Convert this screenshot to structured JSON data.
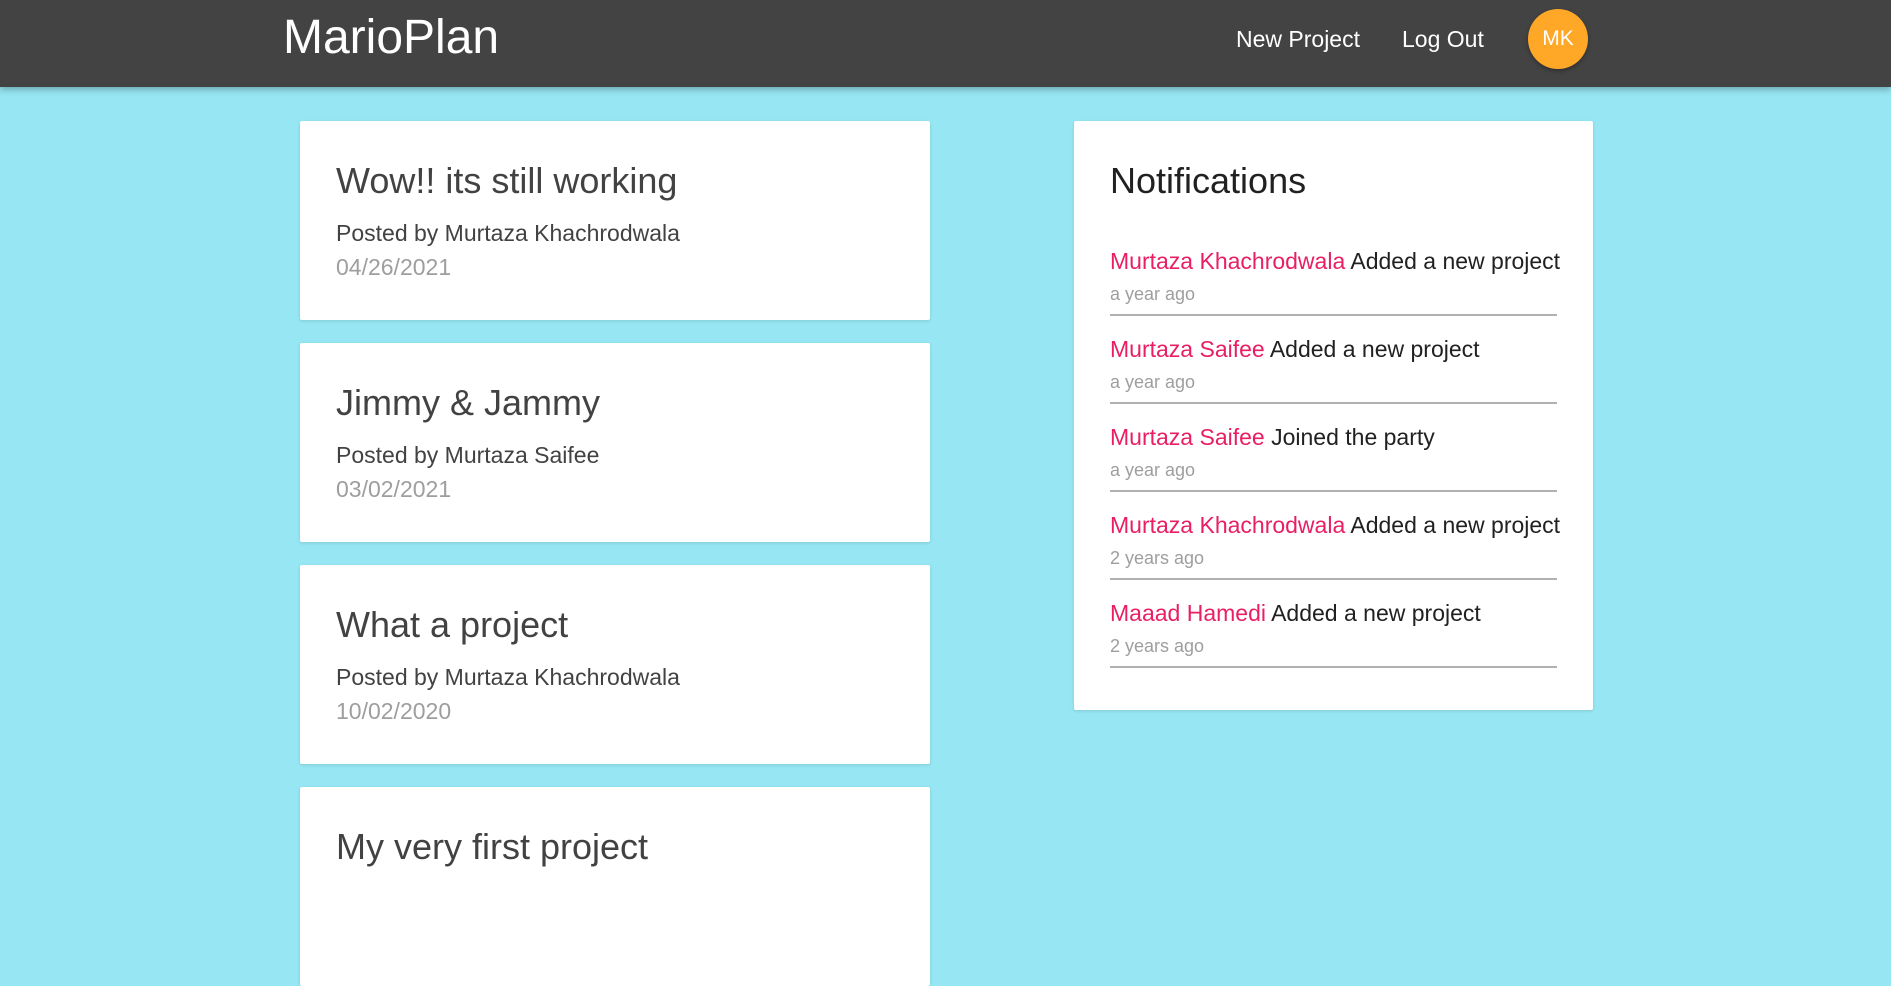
{
  "navbar": {
    "brand": "MarioPlan",
    "links": {
      "new_project": "New Project",
      "log_out": "Log Out"
    },
    "avatar_initials": "MK",
    "avatar_color": "#ffa726",
    "background_color": "#434343"
  },
  "page": {
    "background_color": "#96e6f3"
  },
  "projects": [
    {
      "title": "Wow!! its still working",
      "author": "Posted by Murtaza Khachrodwala",
      "date": "04/26/2021"
    },
    {
      "title": "Jimmy & Jammy",
      "author": "Posted by Murtaza Saifee",
      "date": "03/02/2021"
    },
    {
      "title": "What a project",
      "author": "Posted by Murtaza Khachrodwala",
      "date": "10/02/2020"
    },
    {
      "title": "My very first project",
      "author": "",
      "date": ""
    }
  ],
  "notifications": {
    "title": "Notifications",
    "accent_color": "#e91e63",
    "items": [
      {
        "user": "Murtaza Khachrodwala",
        "content": "Added a new project",
        "time": "a year ago"
      },
      {
        "user": "Murtaza Saifee",
        "content": "Added a new project",
        "time": "a year ago"
      },
      {
        "user": "Murtaza Saifee",
        "content": "Joined the party",
        "time": "a year ago"
      },
      {
        "user": "Murtaza Khachrodwala",
        "content": "Added a new project",
        "time": "2 years ago"
      },
      {
        "user": "Maaad Hamedi",
        "content": "Added a new project",
        "time": "2 years ago"
      }
    ]
  }
}
